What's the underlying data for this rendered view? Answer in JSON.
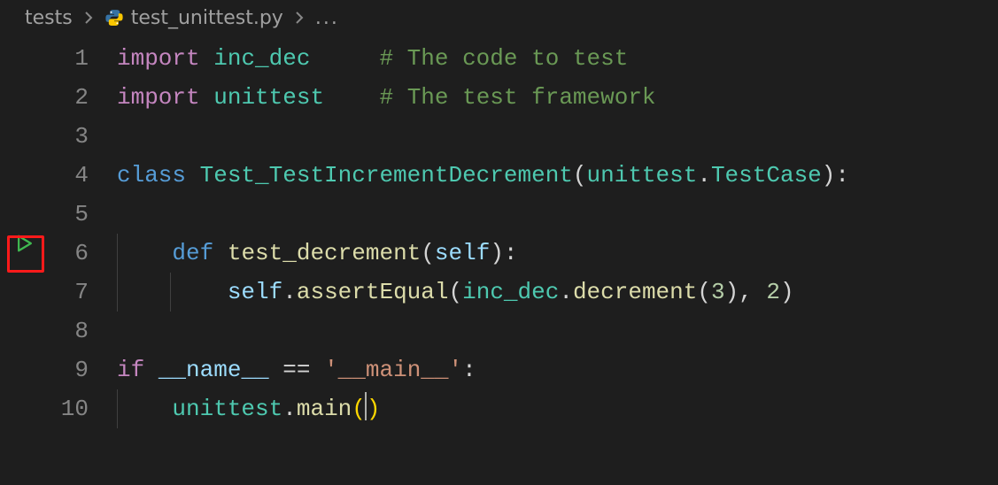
{
  "breadcrumb": {
    "folder": "tests",
    "file": "test_unittest.py",
    "trail": "..."
  },
  "code": {
    "l1": {
      "import": "import",
      "mod": "inc_dec",
      "pad": "     ",
      "cmt": "# The code to test"
    },
    "l2": {
      "import": "import",
      "mod": "unittest",
      "pad": "    ",
      "cmt": "# The test framework"
    },
    "l4": {
      "class": "class",
      "name": "Test_TestIncrementDecrement",
      "lp": "(",
      "base_mod": "unittest",
      "dot": ".",
      "base_cls": "TestCase",
      "rp": ")",
      "colon": ":"
    },
    "l6": {
      "def": "def",
      "name": "test_decrement",
      "lp": "(",
      "self": "self",
      "rp": ")",
      "colon": ":"
    },
    "l7": {
      "self": "self",
      "dot1": ".",
      "assert": "assertEqual",
      "lp": "(",
      "mod": "inc_dec",
      "dot2": ".",
      "dec": "decrement",
      "lp2": "(",
      "n3": "3",
      "rp2": ")",
      "comma": ", ",
      "n2": "2",
      "rp": ")"
    },
    "l9": {
      "if": "if",
      "name": "__name__",
      "eq": " == ",
      "str": "'__main__'",
      "colon": ":"
    },
    "l10": {
      "mod": "unittest",
      "dot": ".",
      "fn": "main",
      "lp": "(",
      "rp": ")"
    }
  },
  "lineno": {
    "1": "1",
    "2": "2",
    "3": "3",
    "4": "4",
    "5": "5",
    "6": "6",
    "7": "7",
    "8": "8",
    "9": "9",
    "10": "10"
  },
  "icons": {
    "run": "run-test-icon",
    "python": "python-file-icon"
  }
}
